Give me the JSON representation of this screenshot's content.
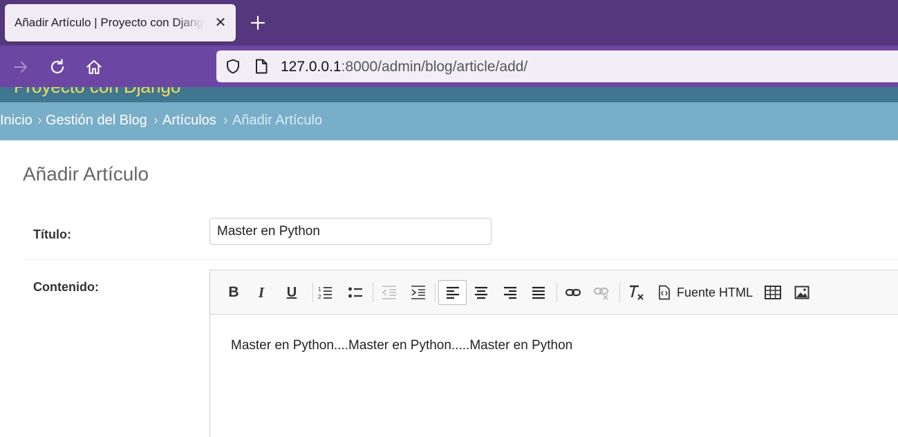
{
  "browser": {
    "tab_title": "Añadir Artículo | Proyecto con Django",
    "url_host": "127.0.0.1",
    "url_path": ":8000/admin/blog/article/add/"
  },
  "site": {
    "header_title": "Proyecto con Django"
  },
  "breadcrumbs": {
    "inicio": "Inicio",
    "gestion": "Gestión del Blog",
    "articulos": "Artículos",
    "current": "Añadir Artículo",
    "separator": "›"
  },
  "page": {
    "title": "Añadir Artículo"
  },
  "form": {
    "titulo_label": "Título:",
    "titulo_value": "Master en Python",
    "contenido_label": "Contenido:",
    "contenido_value": "Master en Python....Master en Python.....Master en Python"
  },
  "toolbar": {
    "source_label": "Fuente HTML",
    "bold": "B",
    "italic": "I",
    "underline": "U"
  },
  "colors": {
    "tabbar": "#55377d",
    "navbar": "#6c46a3",
    "django_header": "#417690",
    "breadcrumbs": "#79aec8"
  }
}
